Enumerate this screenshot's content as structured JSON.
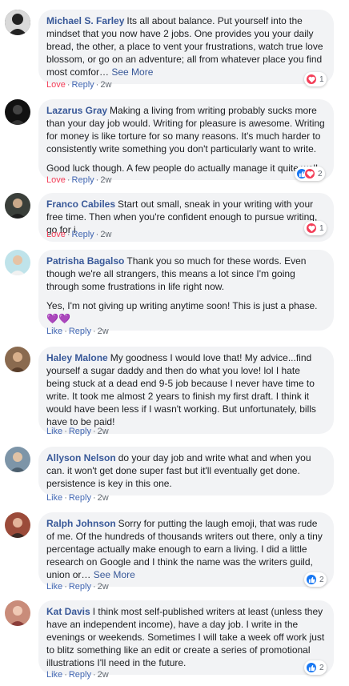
{
  "actions": {
    "love": "Love",
    "like": "Like",
    "reply": "Reply",
    "dot": "·",
    "see_more": "See More"
  },
  "colors": {
    "link": "#385898",
    "love": "#f33e58",
    "like": "#1877f2",
    "bubble": "#f2f3f5"
  },
  "comments": [
    {
      "author": "Michael S. Farley",
      "paragraphs": [
        "Its all about balance. Put yourself into the mindset that you now have 2 jobs. One provides you your daily bread, the other, a place to vent your frustrations, watch true love blossom, or go on an adventure; all from whatever place you find most comfor…"
      ],
      "see_more": true,
      "reaction_action": "Love",
      "time": "2w",
      "reactions": [
        "love-icon"
      ],
      "reaction_count": "1"
    },
    {
      "author": "Lazarus Gray",
      "paragraphs": [
        "Making a living from writing probably sucks more than your day job would. Writing for pleasure is awesome. Writing for money is like torture for so many reasons. It's much harder to consistently write something you don't particularly want to write.",
        "Good luck though. A few people do actually manage it quite well."
      ],
      "see_more": false,
      "reaction_action": "Love",
      "time": "2w",
      "reactions": [
        "like-icon",
        "love-icon"
      ],
      "reaction_count": "2"
    },
    {
      "author": "Franco Cabiles",
      "paragraphs": [
        "Start out small, sneak in your writing with your free time. Then when you're confident enough to pursue writing, go for i"
      ],
      "see_more": false,
      "reaction_action": "Love",
      "time": "2w",
      "reactions": [
        "love-icon"
      ],
      "reaction_count": "1"
    },
    {
      "author": "Patrisha Bagalso",
      "paragraphs": [
        "Thank you so much for these words. Even though we're all strangers, this means a lot since I'm going through some frustrations in life right now.",
        "Yes, I'm not giving up writing anytime soon! This is just a phase. 💜💜"
      ],
      "see_more": false,
      "reaction_action": "Like",
      "time": "2w",
      "reactions": [],
      "reaction_count": ""
    },
    {
      "author": "Haley Malone",
      "paragraphs": [
        "My goodness I would love that! My advice...find yourself a sugar daddy and then do what you love! lol I hate being stuck at a dead end 9-5 job because I never have time to write. It took me almost 2 years to finish my first draft. I think it would have been less if I wasn't working. But unfortunately, bills have to be paid!"
      ],
      "see_more": false,
      "reaction_action": "Like",
      "time": "2w",
      "reactions": [],
      "reaction_count": ""
    },
    {
      "author": "Allyson Nelson",
      "paragraphs": [
        "do your day job and write what and when you can. it won't get done super fast but it'll eventually get done. persistence is key in this one."
      ],
      "see_more": false,
      "reaction_action": "Like",
      "time": "2w",
      "reactions": [],
      "reaction_count": ""
    },
    {
      "author": "Ralph Johnson",
      "paragraphs": [
        "Sorry for putting the laugh emoji, that was rude of me. Of the hundreds of thousands writers out there, only a tiny percentage actually make enough to earn a living. I did a little research on Google and I think the name was the writers guild, union or…"
      ],
      "see_more": true,
      "reaction_action": "Like",
      "time": "2w",
      "reactions": [
        "like-icon"
      ],
      "reaction_count": "2"
    },
    {
      "author": "Kat Davis",
      "paragraphs": [
        "I think most self-published writers at least (unless they have an independent income), have a day job. I write in the evenings or weekends. Sometimes I will take a week off work just to blitz something like an edit or create a series of promotional illustrations I'll need in the future."
      ],
      "see_more": false,
      "reaction_action": "Like",
      "time": "2w",
      "reactions": [
        "like-icon"
      ],
      "reaction_count": "2"
    }
  ]
}
